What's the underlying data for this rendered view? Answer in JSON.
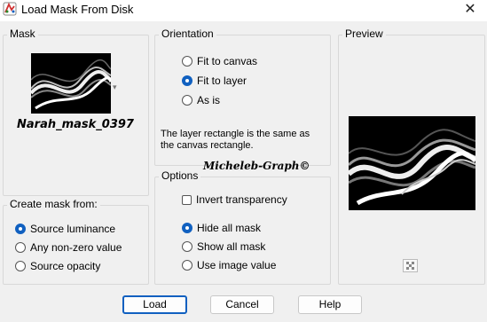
{
  "window": {
    "title": "Load Mask From Disk",
    "close_glyph": "✕"
  },
  "mask": {
    "legend": "Mask",
    "name": "Narah_mask_0397"
  },
  "orientation": {
    "legend": "Orientation",
    "options": [
      "Fit to canvas",
      "Fit to layer",
      "As is"
    ],
    "selected": "Fit to layer",
    "info": "The layer rectangle is the same as the canvas rectangle."
  },
  "watermark": "Micheleb-Graph©",
  "create_mask_from": {
    "legend": "Create mask from:",
    "options": [
      "Source luminance",
      "Any non-zero value",
      "Source opacity"
    ],
    "selected": "Source luminance"
  },
  "options": {
    "legend": "Options",
    "invert_transparency": {
      "label": "Invert transparency",
      "checked": false
    },
    "radios": [
      "Hide all mask",
      "Show all mask",
      "Use image value"
    ],
    "selected": "Hide all mask"
  },
  "preview": {
    "legend": "Preview"
  },
  "buttons": {
    "load": "Load",
    "cancel": "Cancel",
    "help": "Help"
  },
  "colors": {
    "accent": "#1060c0",
    "background": "#f0f0f0"
  }
}
